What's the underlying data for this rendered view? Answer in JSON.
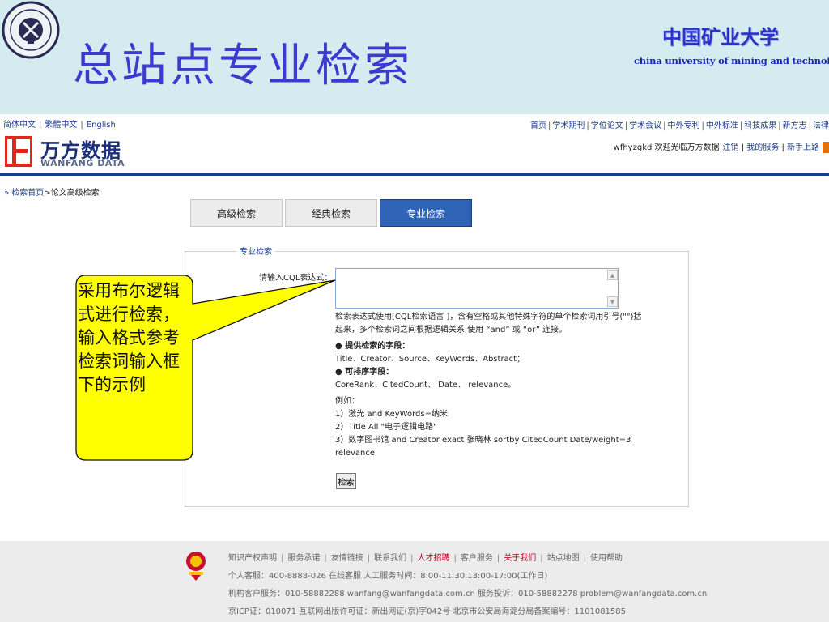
{
  "slide": {
    "title": "总站点专业检索",
    "university_cn": "中国矿业大学",
    "university_en": "china university of mining and technology"
  },
  "lang": [
    "简体中文",
    "繁體中文",
    "English"
  ],
  "logo": {
    "cn": "万方数据",
    "en": "WANFANG DATA"
  },
  "top_nav": [
    "首页",
    "学术期刊",
    "学位论文",
    "学术会议",
    "中外专利",
    "中外标准",
    "科技成果",
    "新方志",
    "法律"
  ],
  "user_bar": {
    "greeting": "wfhyzgkd 欢迎光临万方数据!",
    "logout": "注销",
    "my_service": "我的服务",
    "new_user": "新手上路"
  },
  "breadcrumb": {
    "prefix": "» ",
    "home": "检索首页",
    "arrow": ">",
    "current": "论文高级检索"
  },
  "tabs": [
    {
      "label": "高级检索"
    },
    {
      "label": "经典检索"
    },
    {
      "label": "专业检索"
    }
  ],
  "panel": {
    "legend": "专业检索",
    "field_label": "请输入CQL表达式：",
    "input_value": "",
    "help": [
      "检索表达式使用[CQL检索语言 ]，含有空格或其他特殊字符的单个检索词用引号(\"\")括",
      "起来，多个检索词之间根据逻辑关系 使用 “and” 或 “or” 连接。",
      "● 提供检索的字段：",
      "Title、Creator、Source、KeyWords、Abstract；",
      "● 可排序字段：",
      "CoreRank、CitedCount、 Date、 relevance。",
      "例如：",
      "1）激光  and KeyWords=纳米",
      "2）Title All \"电子逻辑电路\"",
      "3）数字图书馆  and Creator exact 张晓林  sortby CitedCount Date/weight=3",
      "relevance"
    ],
    "submit_label": "检索"
  },
  "callout": {
    "text": "采用布尔逻辑式进行检索，输入格式参考检索词输入框下的示例",
    "fill": "#ffff00"
  },
  "footer": {
    "links": [
      "知识产权声明",
      "服务承诺",
      "友情链接",
      "联系我们",
      "人才招聘",
      "客户服务",
      "关于我们",
      "站点地图",
      "使用帮助"
    ],
    "line2": "个人客服：400-8888-026 在线客服  人工服务时间：8:00-11:30,13:00-17:00(工作日)",
    "line3": "机构客户服务：010-58882288  wanfang@wanfangdata.com.cn    服务投诉：010-58882278 problem@wanfangdata.com.cn",
    "line4": "京ICP证：010071 互联网出版许可证：新出网证(京)字042号 北京市公安局海淀分局备案编号：1101081585"
  },
  "colors": {
    "banner": "#d4ebef",
    "title": "#3b3bd0",
    "brand_blue": "#1b3d8f",
    "active_tab": "#2f63b5",
    "accent_red": "#b5001e"
  }
}
